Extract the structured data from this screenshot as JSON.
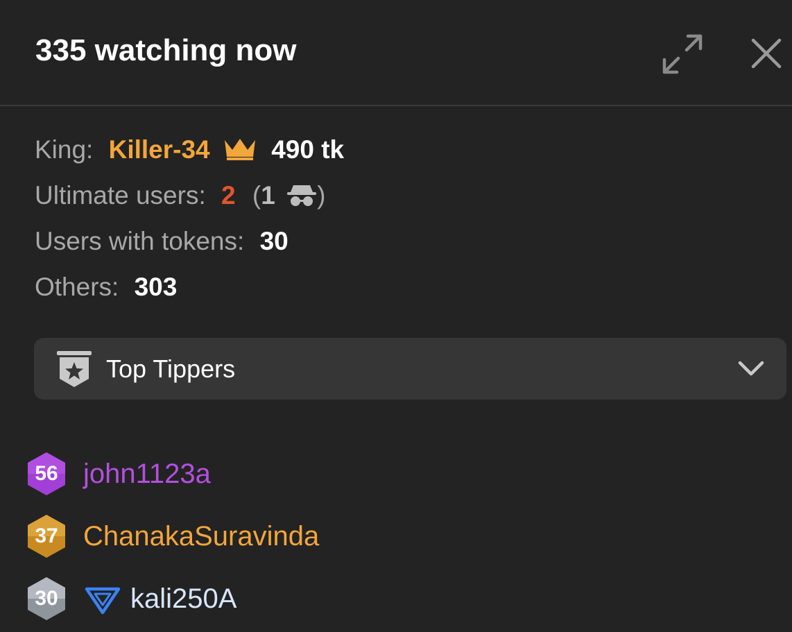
{
  "header": {
    "title": "335 watching now",
    "expand_icon": "expand-icon",
    "close_icon": "close-icon"
  },
  "stats": {
    "king_label": "King:",
    "king_name": "Killer-34",
    "king_amount": "490 tk",
    "ultimate_label": "Ultimate users:",
    "ultimate_count": "2",
    "ultimate_anon_open": "(",
    "ultimate_anon_count": "1",
    "ultimate_anon_close": ")",
    "tokens_label": "Users with tokens:",
    "tokens_count": "30",
    "others_label": "Others:",
    "others_count": "303"
  },
  "dropdown": {
    "label": "Top Tippers",
    "icon": "shield-star-icon"
  },
  "tippers": [
    {
      "level": "56",
      "name": "john1123a",
      "name_color": "#b44fe0",
      "badge_color": "#a23fd6"
    },
    {
      "level": "37",
      "name": "ChanakaSuravinda",
      "name_color": "#f3a63b",
      "badge_color": "#d89a2e"
    },
    {
      "level": "30",
      "name": "kali250A",
      "name_color": "#d8e6ff",
      "badge_color": "#aeb4bc",
      "vip_icon": "blue-triangle-icon"
    }
  ],
  "colors": {
    "background": "#232323",
    "king": "#f3a63b",
    "ultimate": "#e2552b",
    "muted": "#a8a8a8"
  }
}
